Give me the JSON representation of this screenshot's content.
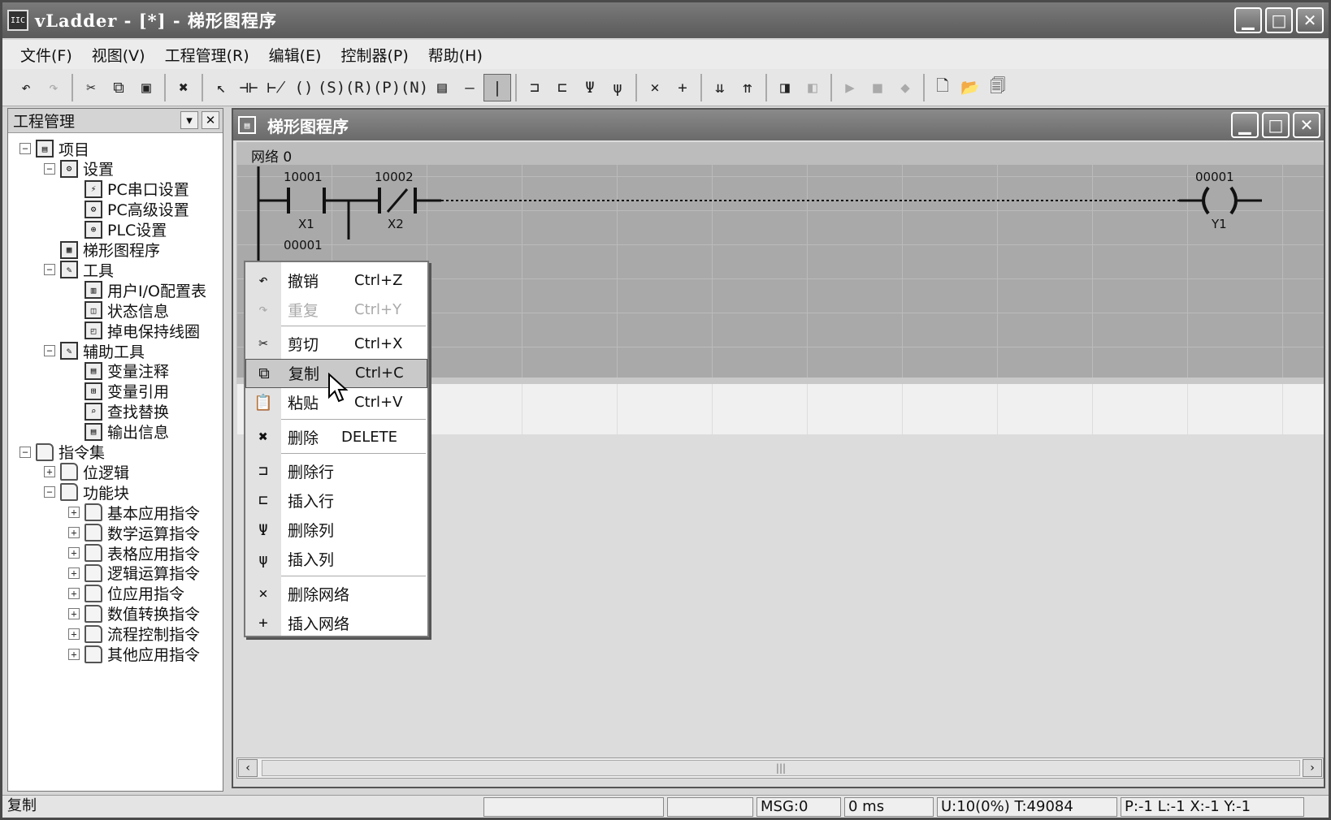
{
  "window": {
    "title": "vLadder - [*] - 梯形图程序",
    "app_icon_text": "IIC",
    "buttons": {
      "minimize": "▁",
      "maximize": "□",
      "close": "✕"
    }
  },
  "menu": [
    "文件(F)",
    "视图(V)",
    "工程管理(R)",
    "编辑(E)",
    "控制器(P)",
    "帮助(H)"
  ],
  "toolbar": {
    "icons": [
      "undo-icon",
      "redo-icon",
      "cut-icon",
      "copy-icon",
      "paste-icon",
      "delete-icon",
      "select-icon",
      "contact-no-icon",
      "contact-nc-icon",
      "coil-icon",
      "set-coil-icon",
      "reset-coil-icon",
      "positive-edge-icon",
      "negative-edge-icon",
      "function-block-icon",
      "horizontal-line-icon",
      "vertical-line-icon",
      "insert-row-icon",
      "delete-row-icon",
      "insert-column-icon",
      "delete-column-icon",
      "delete-network-icon",
      "insert-network-icon",
      "download-icon",
      "upload-icon",
      "monitor-icon",
      "monitor-off-icon",
      "run-icon",
      "stop-icon",
      "compile-icon",
      "new-file-icon",
      "open-folder-icon",
      "save-all-icon"
    ]
  },
  "project_panel": {
    "title": "工程管理",
    "tree": [
      {
        "label": "项目",
        "level": 0,
        "exp": "−",
        "icon": "project-icon"
      },
      {
        "label": "设置",
        "level": 1,
        "exp": "−",
        "icon": "settings-icon"
      },
      {
        "label": "PC串口设置",
        "level": 2,
        "icon": "serial-icon"
      },
      {
        "label": "PC高级设置",
        "level": 2,
        "icon": "advanced-settings-icon"
      },
      {
        "label": "PLC设置",
        "level": 2,
        "icon": "plc-settings-icon"
      },
      {
        "label": "梯形图程序",
        "level": 1,
        "icon": "ladder-program-icon"
      },
      {
        "label": "工具",
        "level": 1,
        "exp": "−",
        "icon": "tools-icon"
      },
      {
        "label": "用户I/O配置表",
        "level": 2,
        "icon": "io-table-icon"
      },
      {
        "label": "状态信息",
        "level": 2,
        "icon": "status-icon"
      },
      {
        "label": "掉电保持线圈",
        "level": 2,
        "icon": "retain-coil-icon"
      },
      {
        "label": "辅助工具",
        "level": 1,
        "exp": "−",
        "icon": "aux-tools-icon"
      },
      {
        "label": "变量注释",
        "level": 2,
        "icon": "var-comment-icon"
      },
      {
        "label": "变量引用",
        "level": 2,
        "icon": "var-reference-icon"
      },
      {
        "label": "查找替换",
        "level": 2,
        "icon": "find-replace-icon"
      },
      {
        "label": "输出信息",
        "level": 2,
        "icon": "output-info-icon"
      },
      {
        "label": "指令集",
        "level": 0,
        "exp": "−",
        "icon": "folder-icon"
      },
      {
        "label": "位逻辑",
        "level": 1,
        "exp": "+",
        "icon": "folder-icon"
      },
      {
        "label": "功能块",
        "level": 1,
        "exp": "−",
        "icon": "folder-icon"
      },
      {
        "label": "基本应用指令",
        "level": 2,
        "exp": "+",
        "icon": "folder-icon"
      },
      {
        "label": "数学运算指令",
        "level": 2,
        "exp": "+",
        "icon": "folder-icon"
      },
      {
        "label": "表格应用指令",
        "level": 2,
        "exp": "+",
        "icon": "folder-icon"
      },
      {
        "label": "逻辑运算指令",
        "level": 2,
        "exp": "+",
        "icon": "folder-icon"
      },
      {
        "label": "位应用指令",
        "level": 2,
        "exp": "+",
        "icon": "folder-icon"
      },
      {
        "label": "数值转换指令",
        "level": 2,
        "exp": "+",
        "icon": "folder-icon"
      },
      {
        "label": "流程控制指令",
        "level": 2,
        "exp": "+",
        "icon": "folder-icon"
      },
      {
        "label": "其他应用指令",
        "level": 2,
        "exp": "+",
        "icon": "folder-icon"
      }
    ]
  },
  "ladder_window": {
    "title": "梯形图程序",
    "network_label": "网络 0",
    "contacts": [
      {
        "addr": "10001",
        "name": "X1",
        "type": "NO"
      },
      {
        "addr": "10002",
        "name": "X2",
        "type": "NC"
      },
      {
        "addr": "00001",
        "name": "",
        "type": "NO"
      }
    ],
    "coil": {
      "addr": "00001",
      "name": "Y1"
    }
  },
  "context_menu": [
    {
      "label": "撤销",
      "shortcut": "Ctrl+Z",
      "icon": "undo-icon",
      "glyph": "↶"
    },
    {
      "label": "重复",
      "shortcut": "Ctrl+Y",
      "icon": "redo-icon",
      "glyph": "↷",
      "disabled": true
    },
    {
      "sep": true
    },
    {
      "label": "剪切",
      "shortcut": "Ctrl+X",
      "icon": "cut-icon",
      "glyph": "✂"
    },
    {
      "label": "复制",
      "shortcut": "Ctrl+C",
      "icon": "copy-icon",
      "glyph": "⧉",
      "highlighted": true
    },
    {
      "label": "粘贴",
      "shortcut": "Ctrl+V",
      "icon": "paste-icon",
      "glyph": "📋"
    },
    {
      "sep": true
    },
    {
      "label": "删除",
      "shortcut": "DELETE",
      "icon": "delete-icon",
      "glyph": "✖"
    },
    {
      "sep": true
    },
    {
      "label": "删除行",
      "shortcut": "",
      "icon": "delete-row-icon",
      "glyph": "⊐"
    },
    {
      "label": "插入行",
      "shortcut": "",
      "icon": "insert-row-icon",
      "glyph": "⊏"
    },
    {
      "label": "删除列",
      "shortcut": "",
      "icon": "delete-column-icon",
      "glyph": "Ψ"
    },
    {
      "label": "插入列",
      "shortcut": "",
      "icon": "insert-column-icon",
      "glyph": "ψ"
    },
    {
      "sep": true
    },
    {
      "label": "删除网络",
      "shortcut": "",
      "icon": "delete-network-icon",
      "glyph": "×"
    },
    {
      "label": "插入网络",
      "shortcut": "",
      "icon": "insert-network-icon",
      "glyph": "+"
    }
  ],
  "statusbar": {
    "message": "复制",
    "msg": "MSG:0",
    "time": "0 ms",
    "usage": "U:10(0%) T:49084",
    "position": "P:-1 L:-1 X:-1 Y:-1"
  }
}
